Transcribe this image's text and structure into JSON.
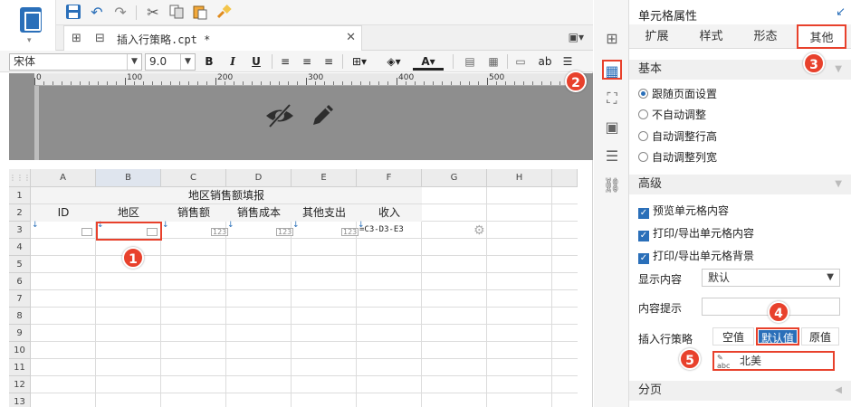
{
  "toolbar": {
    "font_name": "宋体",
    "font_size": "9.0",
    "bold": "B",
    "italic": "I",
    "underline": "U",
    "text_btn": "ab"
  },
  "tab": {
    "filename": "插入行策略.cpt *"
  },
  "ruler": {
    "marks": [
      "0",
      "100",
      "200",
      "300",
      "400",
      "500"
    ]
  },
  "grid": {
    "columns": [
      "A",
      "B",
      "C",
      "D",
      "E",
      "F",
      "G",
      "H"
    ],
    "rows": [
      "1",
      "2",
      "3",
      "4",
      "5",
      "6",
      "7",
      "8",
      "9",
      "10",
      "11",
      "12",
      "13"
    ],
    "title": "地区销售额填报",
    "headers": [
      "ID",
      "地区",
      "销售额",
      "销售成本",
      "其他支出",
      "收入"
    ],
    "formula": "=C3-D3-E3",
    "num_tag": "123"
  },
  "badges": [
    "1",
    "2",
    "3",
    "4",
    "5"
  ],
  "panel": {
    "title": "单元格属性",
    "tabs": [
      "扩展",
      "样式",
      "形态",
      "其他"
    ],
    "section_basic": "基本",
    "radio_options": [
      "跟随页面设置",
      "不自动调整",
      "自动调整行高",
      "自动调整列宽"
    ],
    "section_advanced": "高级",
    "checkboxes": [
      "预览单元格内容",
      "打印/导出单元格内容",
      "打印/导出单元格背景"
    ],
    "display_label": "显示内容",
    "display_value": "默认",
    "tooltip_label": "内容提示",
    "insert_label": "插入行策略",
    "insert_options": [
      "空值",
      "默认值",
      "原值"
    ],
    "default_value": "北美",
    "section_paging": "分页"
  },
  "colors": {
    "accent": "#2a6fb9",
    "highlight": "#e8412c"
  }
}
